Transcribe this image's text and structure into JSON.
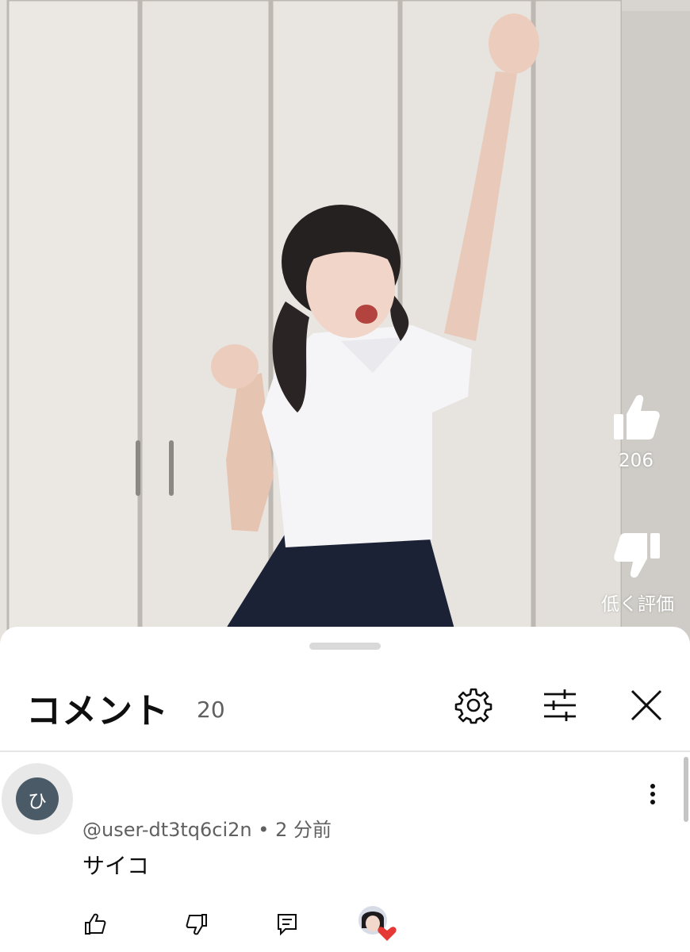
{
  "video": {
    "like_count": "206",
    "dislike_label": "低く評価"
  },
  "comments_panel": {
    "title": "コメント",
    "count": "20",
    "icons": [
      "gear-icon",
      "filter-icon",
      "close-icon"
    ]
  },
  "comments": [
    {
      "avatar_letter": "ひ",
      "author": "@user-dt3tq6ci2n",
      "separator": " • ",
      "time": "2 分前",
      "text": "サイコ",
      "actions": [
        "thumb-up-icon",
        "thumb-down-icon",
        "reply-icon",
        "creator-heart-icon"
      ]
    }
  ]
}
